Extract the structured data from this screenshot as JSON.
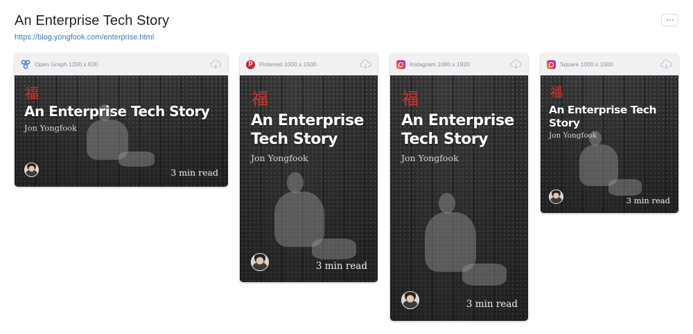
{
  "page": {
    "title": "An Enterprise Tech Story",
    "url": "https://blog.yongfook.com/enterprise.html"
  },
  "previews": [
    {
      "platform": "Open Graph 1200 x 630",
      "icon": "open-graph-icon"
    },
    {
      "platform": "Pinterest 1000 x 1500",
      "icon": "pinterest-icon"
    },
    {
      "platform": "Instagram 1080 x 1920",
      "icon": "instagram-icon"
    },
    {
      "platform": "Square 1000 x 1000",
      "icon": "instagram-icon"
    }
  ],
  "card": {
    "glyph": "福",
    "title": "An Enterprise Tech Story",
    "author": "Jon Yongfook",
    "read_time": "3 min read"
  },
  "colors": {
    "link": "#3a74c9",
    "glyph": "#d9312c",
    "pinterest": "#c8232c"
  }
}
